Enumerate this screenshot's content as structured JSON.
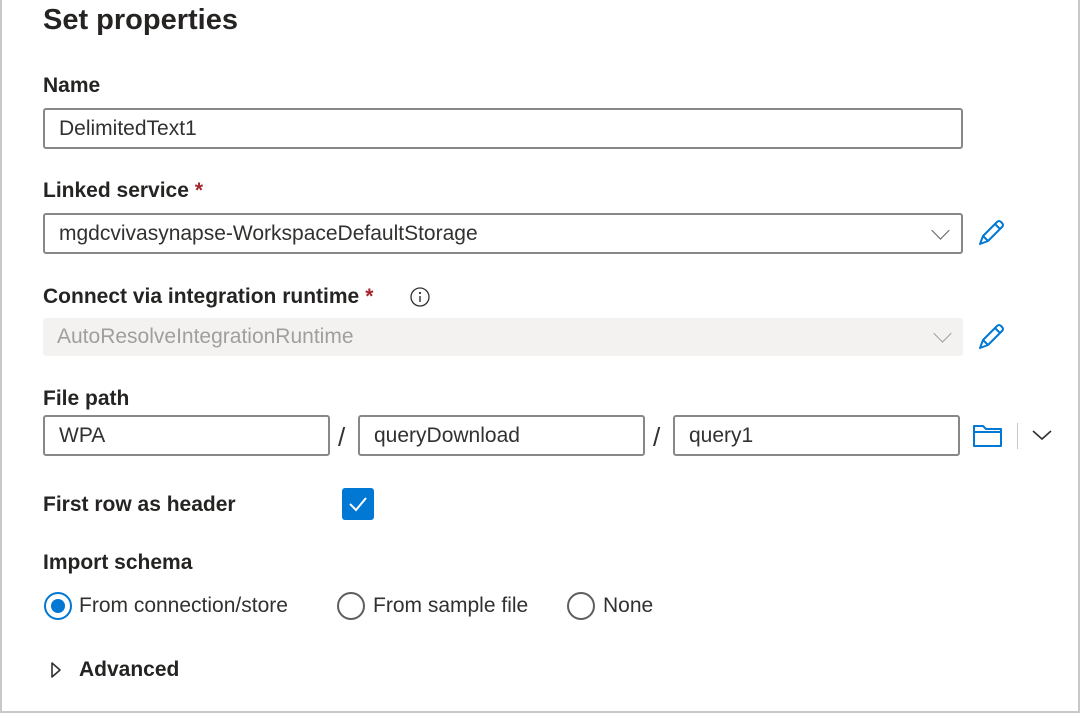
{
  "title": "Set properties",
  "name_field": {
    "label": "Name",
    "value": "DelimitedText1"
  },
  "linked_service": {
    "label": "Linked service",
    "required_mark": "*",
    "value": "mgdcvivasynapse-WorkspaceDefaultStorage"
  },
  "integration_runtime": {
    "label": "Connect via integration runtime",
    "required_mark": "*",
    "value": "AutoResolveIntegrationRuntime"
  },
  "file_path": {
    "label": "File path",
    "container": "WPA",
    "directory": "queryDownload",
    "file": "query1",
    "separator": "/"
  },
  "first_row_header": {
    "label": "First row as header",
    "checked": true
  },
  "import_schema": {
    "label": "Import schema",
    "options": [
      {
        "label": "From connection/store",
        "selected": true
      },
      {
        "label": "From sample file",
        "selected": false
      },
      {
        "label": "None",
        "selected": false
      }
    ]
  },
  "advanced": {
    "label": "Advanced",
    "expanded": false
  },
  "colors": {
    "accent": "#0078d4",
    "required": "#a4262c"
  }
}
